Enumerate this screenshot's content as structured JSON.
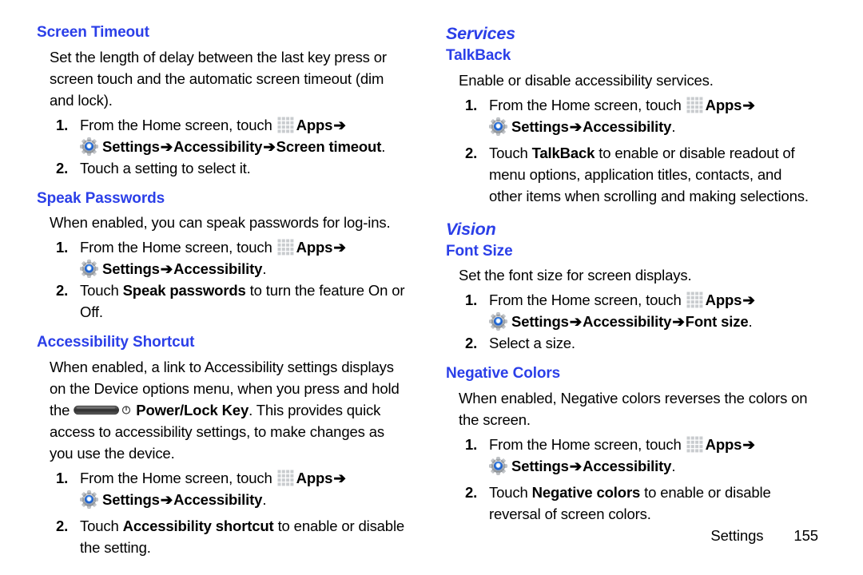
{
  "page": {
    "footer_label": "Settings",
    "footer_page_number": "155",
    "heading_color": "#2b3fe8",
    "body_color": "#000000"
  },
  "icons": {
    "apps": "apps-grid-icon",
    "settings": "settings-gear-icon",
    "power_lock_key": "power-lock-key-icon",
    "arrow": "➔"
  },
  "left_column": {
    "sections": [
      {
        "type": "topic",
        "title": "Screen Timeout",
        "paragraphs": [
          "Set the length of delay between the last key press or screen touch and the automatic screen timeout (dim and lock)."
        ],
        "steps": [
          {
            "num": "1.",
            "lead": "From the Home screen, touch",
            "apps_label": "Apps",
            "sub_path": [
              "Settings",
              "Accessibility",
              "Screen timeout"
            ],
            "sub_suffix": "."
          },
          {
            "num": "2.",
            "plain": "Touch a setting to select it."
          }
        ]
      },
      {
        "type": "topic",
        "title": "Speak Passwords",
        "paragraphs": [
          "When enabled, you can speak passwords for log-ins."
        ],
        "steps": [
          {
            "num": "1.",
            "lead": "From the Home screen, touch",
            "apps_label": "Apps",
            "sub_path": [
              "Settings",
              "Accessibility"
            ],
            "sub_suffix": "."
          },
          {
            "num": "2.",
            "prefix": "Touch ",
            "bold": "Speak passwords",
            "suffix": " to turn the feature On or Off."
          }
        ]
      },
      {
        "type": "topic",
        "title": "Accessibility Shortcut",
        "paragraph_parts": {
          "before_icon": "When enabled, a link to Accessibility settings displays on the Device options menu, when you press and hold the ",
          "bold_after_icon": "Power/Lock Key",
          "after_bold": ". This provides quick access to accessibility settings, to make changes as you use the device."
        },
        "steps": [
          {
            "num": "1.",
            "lead": "From the Home screen, touch",
            "apps_label": "Apps",
            "sub_path": [
              "Settings",
              "Accessibility"
            ],
            "sub_suffix": "."
          },
          {
            "num": "2.",
            "prefix": "Touch ",
            "bold": "Accessibility shortcut",
            "suffix": " to enable or disable the setting."
          }
        ]
      }
    ]
  },
  "right_column": {
    "sections": [
      {
        "type": "section",
        "title": "Services"
      },
      {
        "type": "topic",
        "title": "TalkBack",
        "paragraphs": [
          "Enable or disable accessibility services."
        ],
        "steps": [
          {
            "num": "1.",
            "lead": "From the Home screen, touch",
            "apps_label": "Apps",
            "sub_path": [
              "Settings",
              "Accessibility"
            ],
            "sub_suffix": "."
          },
          {
            "num": "2.",
            "prefix": "Touch ",
            "bold": "TalkBack",
            "suffix": " to enable or disable readout of menu options, application titles, contacts, and other items when scrolling and making selections."
          }
        ]
      },
      {
        "type": "section",
        "title": "Vision"
      },
      {
        "type": "topic",
        "title": "Font Size",
        "paragraphs": [
          "Set the font size for screen displays."
        ],
        "steps": [
          {
            "num": "1.",
            "lead": "From the Home screen, touch",
            "apps_label": "Apps",
            "sub_path": [
              "Settings",
              "Accessibility",
              "Font size"
            ],
            "sub_suffix": "."
          },
          {
            "num": "2.",
            "plain": "Select a size."
          }
        ]
      },
      {
        "type": "topic",
        "title": "Negative Colors",
        "paragraphs": [
          "When enabled, Negative colors reverses the colors on the screen."
        ],
        "steps": [
          {
            "num": "1.",
            "lead": "From the Home screen, touch",
            "apps_label": "Apps",
            "sub_path": [
              "Settings",
              "Accessibility"
            ],
            "sub_suffix": "."
          },
          {
            "num": "2.",
            "prefix": "Touch ",
            "bold": "Negative colors",
            "suffix": " to enable or disable reversal of screen colors."
          }
        ]
      }
    ]
  }
}
